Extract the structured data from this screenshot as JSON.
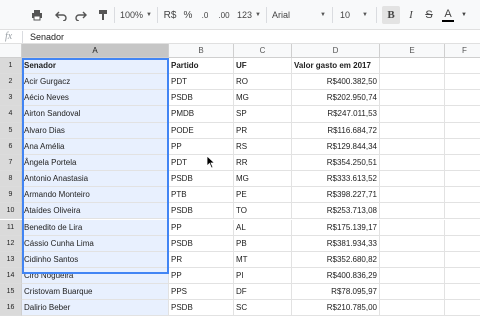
{
  "toolbar": {
    "zoom": "100%",
    "currency": "R$",
    "percent": "%",
    "decimal_decrease": ".0",
    "decimal_increase": ".00",
    "more_formats": "123",
    "font": "Arial",
    "font_size": "10",
    "bold": "B",
    "italic": "I",
    "strikethrough": "S",
    "text_color": "A"
  },
  "formula_bar": {
    "fx": "fx",
    "value": "Senador"
  },
  "columns": [
    "A",
    "B",
    "C",
    "D",
    "E",
    "F"
  ],
  "rows": [
    {
      "n": "1",
      "senador": "Senador",
      "partido": "Partido",
      "uf": "UF",
      "valor": "Valor gasto em 2017"
    },
    {
      "n": "2",
      "senador": "Acir Gurgacz",
      "partido": "PDT",
      "uf": "RO",
      "valor": "R$400.382,50"
    },
    {
      "n": "3",
      "senador": "Aécio Neves",
      "partido": "PSDB",
      "uf": "MG",
      "valor": "R$202.950,74"
    },
    {
      "n": "4",
      "senador": "Airton Sandoval",
      "partido": "PMDB",
      "uf": "SP",
      "valor": "R$247.011,53"
    },
    {
      "n": "5",
      "senador": "Alvaro Dias",
      "partido": "PODE",
      "uf": "PR",
      "valor": "R$116.684,72"
    },
    {
      "n": "6",
      "senador": "Ana Amélia",
      "partido": "PP",
      "uf": "RS",
      "valor": "R$129.844,34"
    },
    {
      "n": "7",
      "senador": "Ângela Portela",
      "partido": "PDT",
      "uf": "RR",
      "valor": "R$354.250,51"
    },
    {
      "n": "8",
      "senador": "Antonio Anastasia",
      "partido": "PSDB",
      "uf": "MG",
      "valor": "R$333.613,52"
    },
    {
      "n": "9",
      "senador": "Armando Monteiro",
      "partido": "PTB",
      "uf": "PE",
      "valor": "R$398.227,71"
    },
    {
      "n": "10",
      "senador": "Ataídes Oliveira",
      "partido": "PSDB",
      "uf": "TO",
      "valor": "R$253.713,08"
    },
    {
      "n": "11",
      "senador": "Benedito de Lira",
      "partido": "PP",
      "uf": "AL",
      "valor": "R$175.139,17"
    },
    {
      "n": "12",
      "senador": "Cássio Cunha Lima",
      "partido": "PSDB",
      "uf": "PB",
      "valor": "R$381.934,33"
    },
    {
      "n": "13",
      "senador": "Cidinho Santos",
      "partido": "PR",
      "uf": "MT",
      "valor": "R$352.680,82"
    },
    {
      "n": "14",
      "senador": "Ciro Nogueira",
      "partido": "PP",
      "uf": "PI",
      "valor": "R$400.836,29"
    },
    {
      "n": "15",
      "senador": "Cristovam Buarque",
      "partido": "PPS",
      "uf": "DF",
      "valor": "R$78.095,97"
    },
    {
      "n": "16",
      "senador": "Dalirio Beber",
      "partido": "PSDB",
      "uf": "SC",
      "valor": "R$210.785,00"
    }
  ]
}
